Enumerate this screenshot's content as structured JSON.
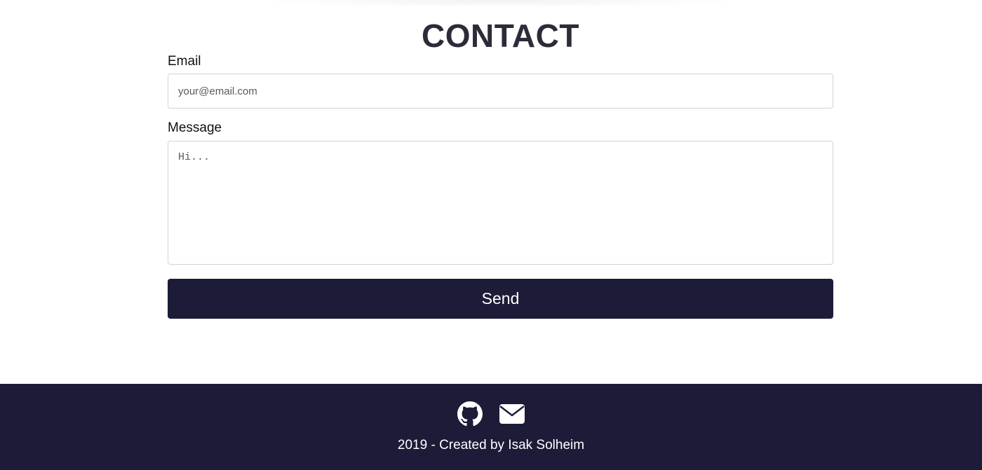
{
  "contact": {
    "title": "CONTACT",
    "email_label": "Email",
    "email_placeholder": "your@email.com",
    "email_value": "",
    "message_label": "Message",
    "message_placeholder": "Hi...",
    "message_value": "",
    "send_label": "Send"
  },
  "footer": {
    "icons": [
      "github-icon",
      "mail-icon"
    ],
    "credit": "2019 - Created by Isak Solheim"
  },
  "colors": {
    "accent": "#1c1b38",
    "title": "#2b2b3a",
    "background": "#ffffff"
  }
}
